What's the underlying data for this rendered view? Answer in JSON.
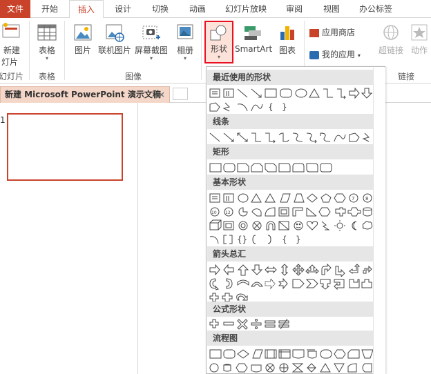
{
  "tabs": [
    {
      "label": "文件",
      "key": "file"
    },
    {
      "label": "开始",
      "key": "home"
    },
    {
      "label": "插入",
      "key": "insert"
    },
    {
      "label": "设计",
      "key": "design"
    },
    {
      "label": "切换",
      "key": "transitions"
    },
    {
      "label": "动画",
      "key": "animations"
    },
    {
      "label": "幻灯片放映",
      "key": "slideshow"
    },
    {
      "label": "审阅",
      "key": "review"
    },
    {
      "label": "视图",
      "key": "view"
    },
    {
      "label": "办公标签",
      "key": "officetab"
    }
  ],
  "ribbon": {
    "new_slide_line1": "新建",
    "new_slide_line2": "灯片",
    "slides_group": "幻灯片",
    "table": "表格",
    "table_group": "表格",
    "picture": "图片",
    "online_picture": "联机图片",
    "screenshot": "屏幕截图",
    "album": "相册",
    "images_group": "图像",
    "shapes": "形状",
    "smartart": "SmartArt",
    "chart": "图表",
    "store": "应用商店",
    "my_apps": "我的应用",
    "hyperlink": "超链接",
    "action": "动作",
    "links_group": "链接"
  },
  "document": {
    "tab_title": "新建 Microsoft PowerPoint 演示文稿",
    "close": "×",
    "slide_number": "1"
  },
  "shapes_menu": {
    "categories": [
      "最近使用的形状",
      "线条",
      "矩形",
      "基本形状",
      "箭头总汇",
      "公式形状",
      "流程图"
    ]
  },
  "colors": {
    "accent": "#c9432b",
    "highlight_border": "#e81123"
  }
}
